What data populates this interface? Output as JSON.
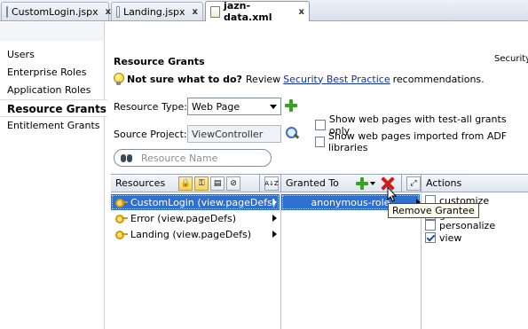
{
  "tabs": [
    {
      "label": "CustomLogin.jspx",
      "active": false
    },
    {
      "label": "Landing.jspx",
      "active": false
    },
    {
      "label": "jazn-data.xml",
      "active": true
    }
  ],
  "close_glyph": "x",
  "nav": {
    "items": [
      "Users",
      "Enterprise Roles",
      "Application Roles",
      "Resource Grants",
      "Entitlement Grants"
    ],
    "selected": "Resource Grants"
  },
  "main": {
    "title": "Resource Grants",
    "security_clip": "Security",
    "hint": {
      "prefix": "Not sure what to do?",
      "review": "Review",
      "link": "Security Best Practice",
      "suffix": "recommendations."
    },
    "resource_type": {
      "label": "Resource Type:",
      "value": "Web Page"
    },
    "source_project": {
      "label": "Source Project:",
      "value": "ViewController"
    },
    "checkboxes": [
      {
        "label": "Show web pages with test-all grants only",
        "checked": false
      },
      {
        "label": "Show web pages imported from ADF libraries",
        "checked": false
      }
    ],
    "search": {
      "placeholder": "Resource Name"
    }
  },
  "grid": {
    "resources_header": "Resources",
    "sort_glyph": "A↓Z",
    "granted_header": "Granted To",
    "actions_header": "Actions",
    "resources": [
      {
        "label": "CustomLogin (view.pageDefs)",
        "selected": true
      },
      {
        "label": "Error (view.pageDefs)",
        "selected": false
      },
      {
        "label": "Landing (view.pageDefs)",
        "selected": false
      }
    ],
    "grantees": [
      {
        "label": "anonymous-role",
        "selected": true
      }
    ],
    "actions": [
      {
        "label": "customize",
        "checked": false
      },
      {
        "label": "grant",
        "checked": false
      },
      {
        "label": "personalize",
        "checked": false
      },
      {
        "label": "view",
        "checked": true
      }
    ],
    "tooltip": "Remove Grantee"
  },
  "colors": {
    "selection": "#2f6fd0",
    "link": "#0b2fb8",
    "add_green": "#33a320",
    "remove_red": "#d21b1b"
  }
}
